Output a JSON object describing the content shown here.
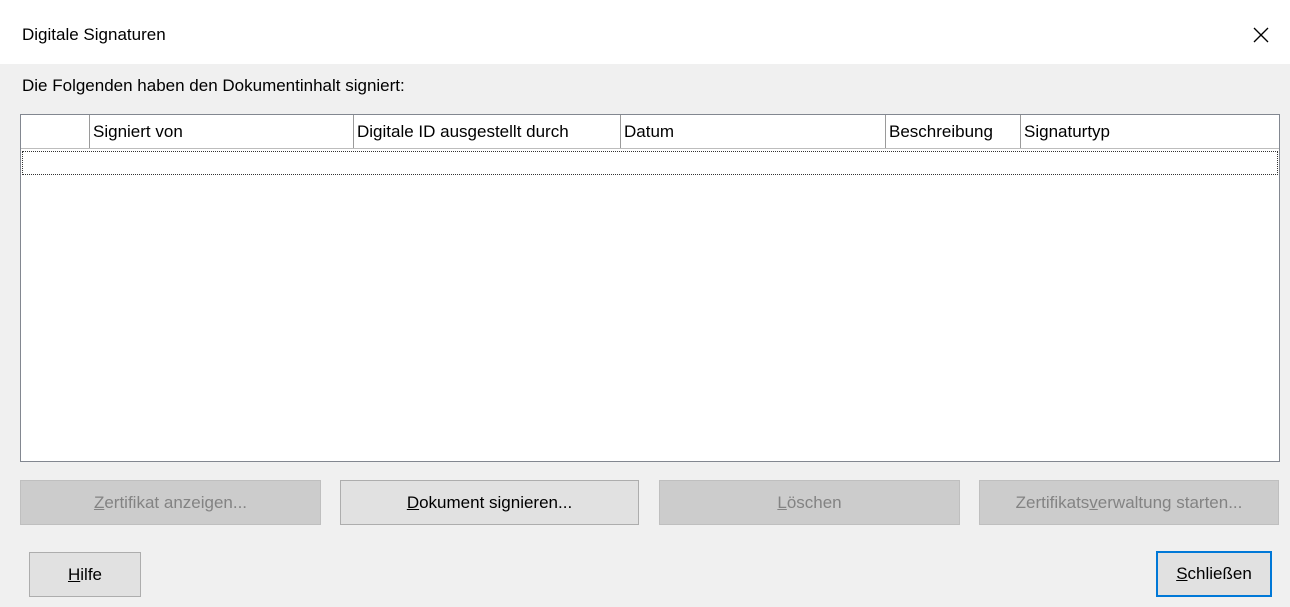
{
  "window": {
    "title": "Digitale Signaturen",
    "close_icon": "close-icon"
  },
  "intro_text": "Die Folgenden haben den Dokumentinhalt signiert:",
  "table": {
    "columns": [
      "",
      "Signiert von",
      "Digitale ID ausgestellt durch",
      "Datum",
      "Beschreibung",
      "Signaturtyp"
    ],
    "rows": []
  },
  "buttons": {
    "view_certificate": {
      "pre": "",
      "mnemonic": "Z",
      "post": "ertifikat anzeigen...",
      "enabled": false
    },
    "sign_document": {
      "pre": "",
      "mnemonic": "D",
      "post": "okument signieren...",
      "enabled": true
    },
    "remove": {
      "pre": "",
      "mnemonic": "L",
      "post": "öschen",
      "enabled": false
    },
    "start_cert_manager": {
      "pre": "Zertifikats",
      "mnemonic": "v",
      "post": "erwaltung starten...",
      "enabled": false
    },
    "help": {
      "pre": "",
      "mnemonic": "H",
      "post": "ilfe",
      "enabled": true
    },
    "close": {
      "pre": "",
      "mnemonic": "S",
      "post": "chließen",
      "enabled": true
    }
  },
  "colors": {
    "focus_border": "#0078d7",
    "disabled_text": "#838383"
  }
}
